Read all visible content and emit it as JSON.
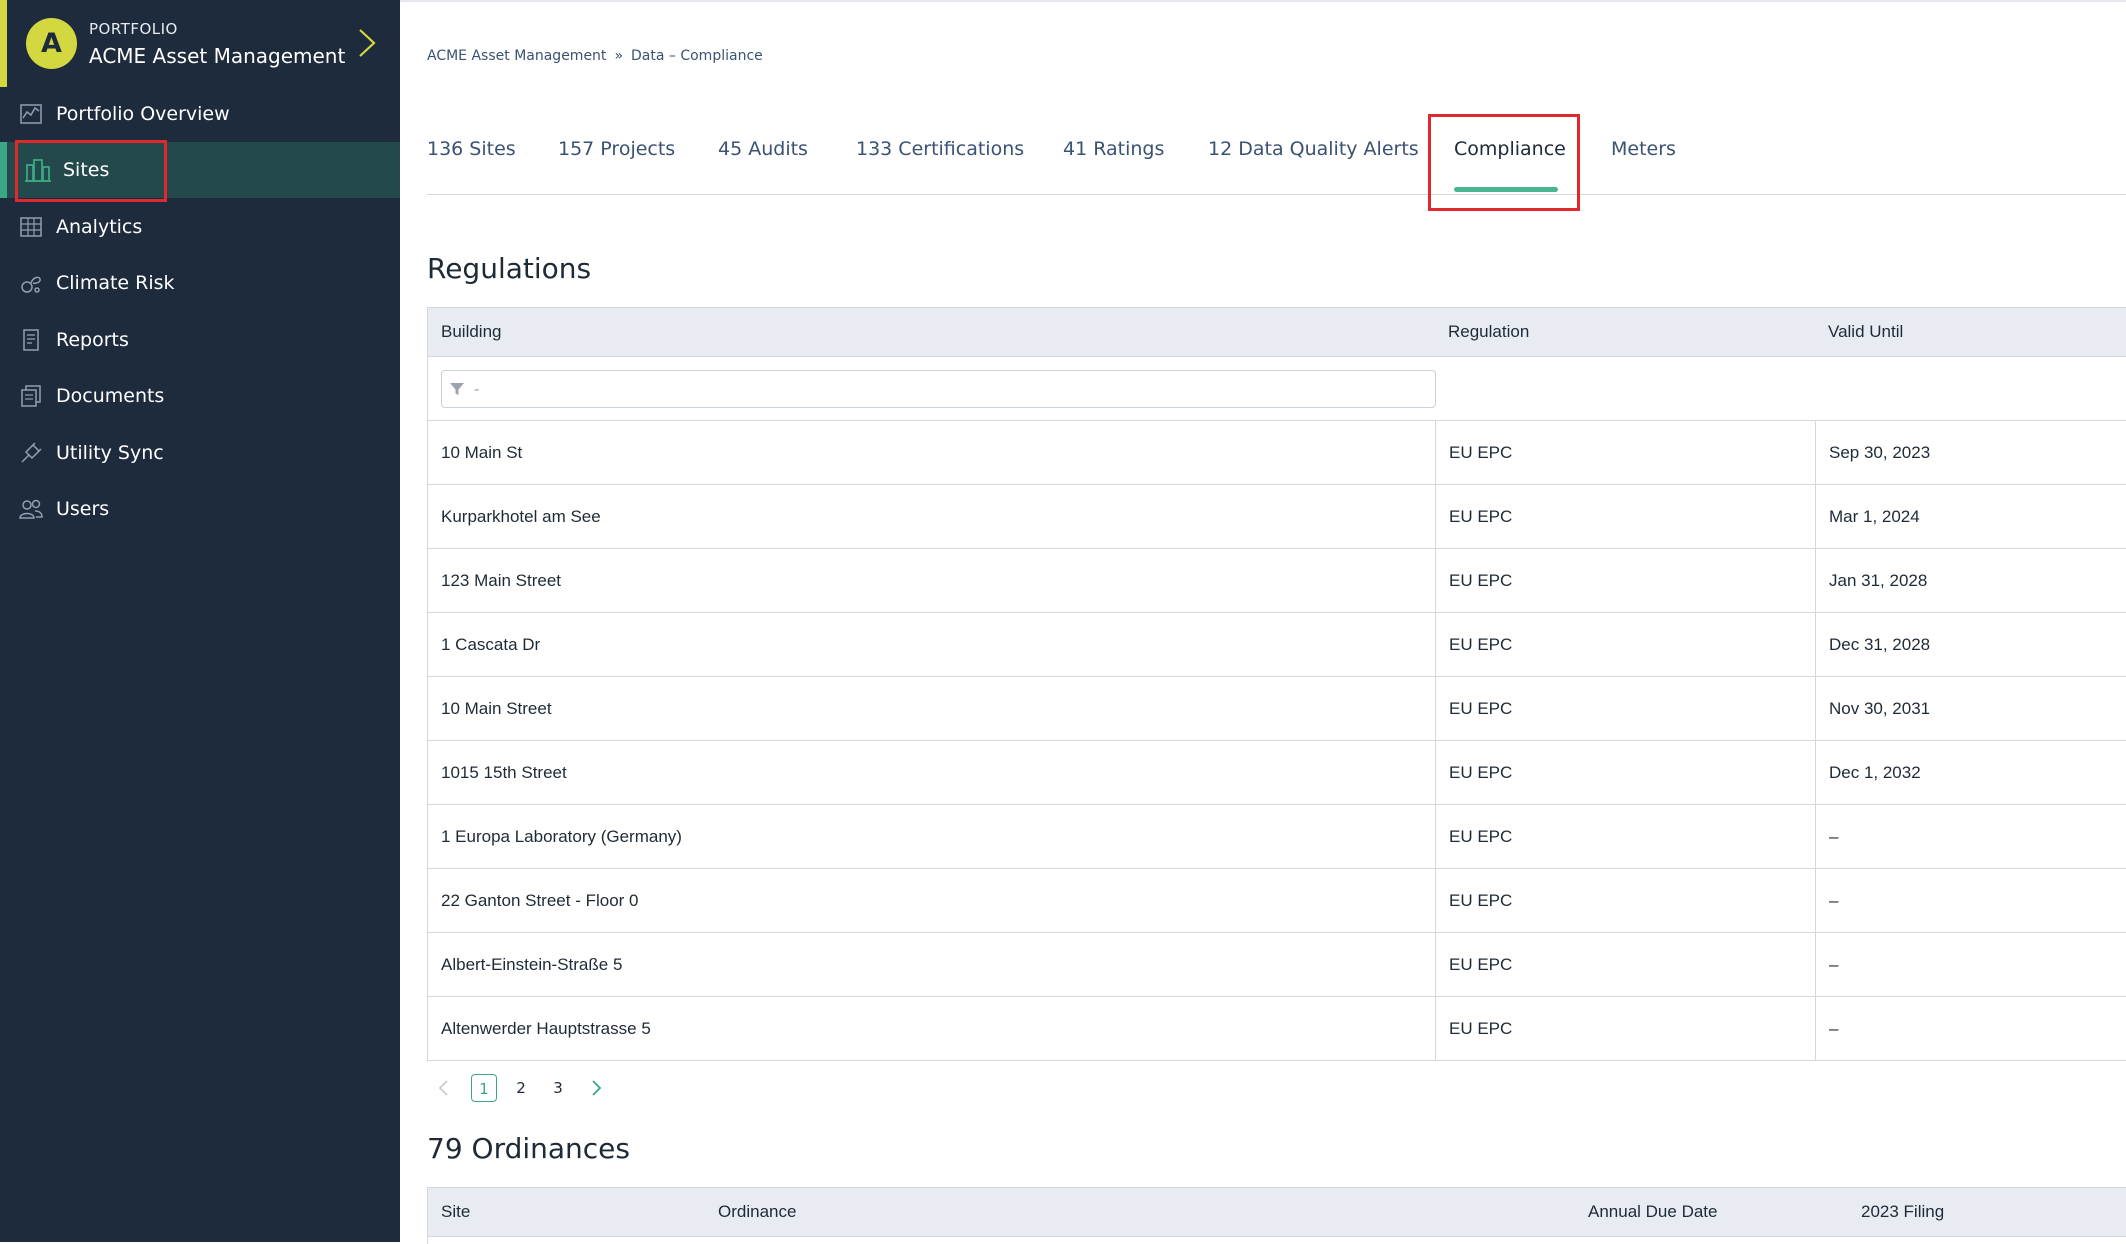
{
  "sidebar": {
    "avatar_letter": "A",
    "portfolio_label": "PORTFOLIO",
    "portfolio_name": "ACME Asset Management",
    "items": [
      {
        "label": "Portfolio Overview",
        "icon": "chart-icon"
      },
      {
        "label": "Sites",
        "icon": "buildings-icon",
        "active": true
      },
      {
        "label": "Analytics",
        "icon": "analytics-grid-icon"
      },
      {
        "label": "Climate Risk",
        "icon": "climate-icon"
      },
      {
        "label": "Reports",
        "icon": "report-icon"
      },
      {
        "label": "Documents",
        "icon": "documents-icon"
      },
      {
        "label": "Utility Sync",
        "icon": "plug-icon"
      },
      {
        "label": "Users",
        "icon": "users-icon"
      }
    ]
  },
  "breadcrumb": {
    "root": "ACME Asset Management",
    "separator": "»",
    "current": "Data – Compliance"
  },
  "tabs": [
    {
      "label": "136 Sites"
    },
    {
      "label": "157 Projects"
    },
    {
      "label": "45 Audits"
    },
    {
      "label": "133 Certifications"
    },
    {
      "label": "41 Ratings"
    },
    {
      "label": "12 Data Quality Alerts"
    },
    {
      "label": "Compliance",
      "active": true
    },
    {
      "label": "Meters"
    }
  ],
  "regulations": {
    "title": "Regulations",
    "columns": [
      "Building",
      "Regulation",
      "Valid Until"
    ],
    "filter_placeholder": "-",
    "rows": [
      [
        "10 Main St",
        "EU EPC",
        "Sep 30, 2023"
      ],
      [
        "Kurparkhotel am See",
        "EU EPC",
        "Mar 1, 2024"
      ],
      [
        "123 Main Street",
        "EU EPC",
        "Jan 31, 2028"
      ],
      [
        "1 Cascata Dr",
        "EU EPC",
        "Dec 31, 2028"
      ],
      [
        "10 Main Street",
        "EU EPC",
        "Nov 30, 2031"
      ],
      [
        "1015 15th Street",
        "EU EPC",
        "Dec 1, 2032"
      ],
      [
        "1 Europa Laboratory (Germany)",
        "EU EPC",
        "–"
      ],
      [
        "22 Ganton Street - Floor 0",
        "EU EPC",
        "–"
      ],
      [
        "Albert-Einstein-Straße 5",
        "EU EPC",
        "–"
      ],
      [
        "Altenwerder Hauptstrasse 5",
        "EU EPC",
        "–"
      ]
    ],
    "pages": [
      "1",
      "2",
      "3"
    ],
    "current_page": "1"
  },
  "ordinances": {
    "title": "79 Ordinances",
    "columns": [
      "Site",
      "Ordinance",
      "Annual Due Date",
      "2023 Filing"
    ]
  },
  "colors": {
    "sidebar_bg": "#1e2b3c",
    "accent_green": "#3aa882",
    "avatar_yellow": "#d4d840",
    "highlight_red": "#e0292c"
  }
}
